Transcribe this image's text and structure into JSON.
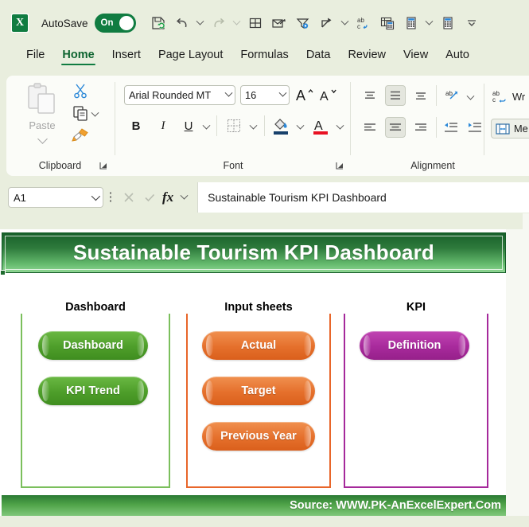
{
  "titlebar": {
    "app_icon": "excel-logo-icon",
    "autosave_label": "AutoSave",
    "autosave_state": "On",
    "qat_icons": [
      {
        "name": "save-icon",
        "label": "Save"
      },
      {
        "name": "undo-icon",
        "label": "Undo"
      },
      {
        "name": "redo-icon",
        "label": "Redo"
      },
      {
        "name": "table-grid-icon",
        "label": "Table"
      },
      {
        "name": "attach-send-icon",
        "label": "Send"
      },
      {
        "name": "filter-settings-icon",
        "label": "Custom Filter"
      },
      {
        "name": "share-icon",
        "label": "Share"
      },
      {
        "name": "spelling-icon",
        "label": "Spelling"
      },
      {
        "name": "insert-function-table-icon",
        "label": "Insert Table"
      },
      {
        "name": "calculator-icon",
        "label": "Calculator"
      },
      {
        "name": "calculator-alt-icon",
        "label": "Calculator"
      },
      {
        "name": "customize-qat-icon",
        "label": "Customize Quick Access Toolbar"
      }
    ]
  },
  "ribbon_tabs": [
    {
      "label": "File",
      "active": false
    },
    {
      "label": "Home",
      "active": true
    },
    {
      "label": "Insert",
      "active": false
    },
    {
      "label": "Page Layout",
      "active": false
    },
    {
      "label": "Formulas",
      "active": false
    },
    {
      "label": "Data",
      "active": false
    },
    {
      "label": "Review",
      "active": false
    },
    {
      "label": "View",
      "active": false
    },
    {
      "label": "Auto",
      "active": false
    }
  ],
  "ribbon": {
    "clipboard": {
      "group_label": "Clipboard",
      "paste_label": "Paste",
      "cut_label": "Cut",
      "copy_label": "Copy",
      "format_painter_label": "Format Painter",
      "dialog_launcher": "clipboard-dialog-launcher"
    },
    "font": {
      "group_label": "Font",
      "font_name": "Arial Rounded MT",
      "font_size": "16",
      "grow_font": "A",
      "shrink_font": "A",
      "bold": "B",
      "italic": "I",
      "underline": "U",
      "borders_label": "Borders",
      "fill_color_label": "Fill Color",
      "font_color_label": "Font Color",
      "dialog_launcher": "font-dialog-launcher"
    },
    "alignment": {
      "group_label": "Alignment",
      "top_align": "Top Align",
      "middle_align": "Middle Align",
      "bottom_align": "Bottom Align",
      "orientation_label": "Orientation",
      "align_left": "Align Left",
      "align_center": "Center",
      "align_right": "Align Right",
      "decrease_indent": "Decrease Indent",
      "increase_indent": "Increase Indent",
      "wrap_text_label": "Wr",
      "merge_label": "Me"
    }
  },
  "formula_bar": {
    "name_box_value": "A1",
    "cancel_icon": "cancel-icon",
    "enter_icon": "confirm-icon",
    "fx_label": "fx",
    "formula_value": "Sustainable Tourism KPI Dashboard",
    "more_options_icon": "more-options-icon"
  },
  "sheet": {
    "banner_title": "Sustainable Tourism KPI Dashboard",
    "footer_source": "Source: WWW.PK-AnExcelExpert.Com",
    "panels": [
      {
        "title": "Dashboard",
        "accent": "#7bbf5c",
        "buttons": [
          {
            "label": "Dashboard",
            "color_top": "#5aa832",
            "color_bottom": "#3e8f21"
          },
          {
            "label": "KPI Trend",
            "color_top": "#5aa832",
            "color_bottom": "#3e8f21"
          }
        ]
      },
      {
        "title": "Input sheets",
        "accent": "#e8662a",
        "buttons": [
          {
            "label": "Actual",
            "color_top": "#ec8040",
            "color_bottom": "#d9611f"
          },
          {
            "label": "Target",
            "color_top": "#ec8040",
            "color_bottom": "#d9611f"
          },
          {
            "label": "Previous Year",
            "color_top": "#ec8040",
            "color_bottom": "#d9611f"
          }
        ]
      },
      {
        "title": "KPI",
        "accent": "#a5299b",
        "buttons": [
          {
            "label": "Definition",
            "color_top": "#b52fa8",
            "color_bottom": "#951f8b"
          }
        ]
      }
    ]
  },
  "colors": {
    "window_bg": "#e9eede",
    "excel_green": "#107c41",
    "banner_dark": "#17602a",
    "banner_light": "#8fd693",
    "tab_accent": "#107c41"
  }
}
